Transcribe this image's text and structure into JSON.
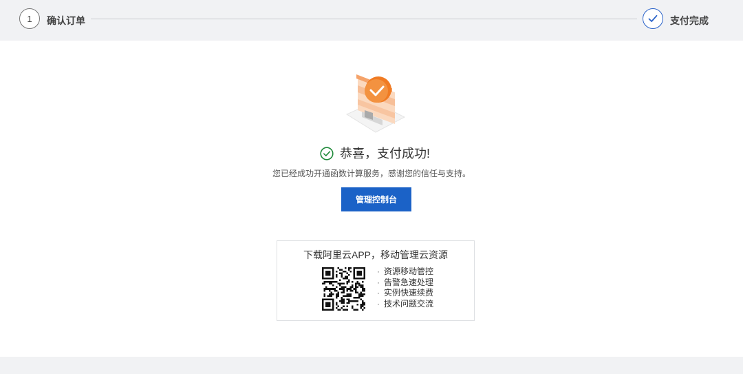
{
  "steps": [
    {
      "number": "1",
      "label": "确认订单"
    },
    {
      "label": "支付完成"
    }
  ],
  "result": {
    "title": "恭喜，支付成功!",
    "subtitle": "您已经成功开通函数计算服务，感谢您的信任与支持。",
    "button": "管理控制台"
  },
  "app": {
    "title": "下载阿里云APP，移动管理云资源",
    "features": [
      "资源移动管控",
      "告警急速处理",
      "实例快速续费",
      "技术问题交流"
    ]
  },
  "colors": {
    "accent": "#1b62c7",
    "success": "#1f8a3a",
    "illustration_orange": "#f07b23"
  }
}
